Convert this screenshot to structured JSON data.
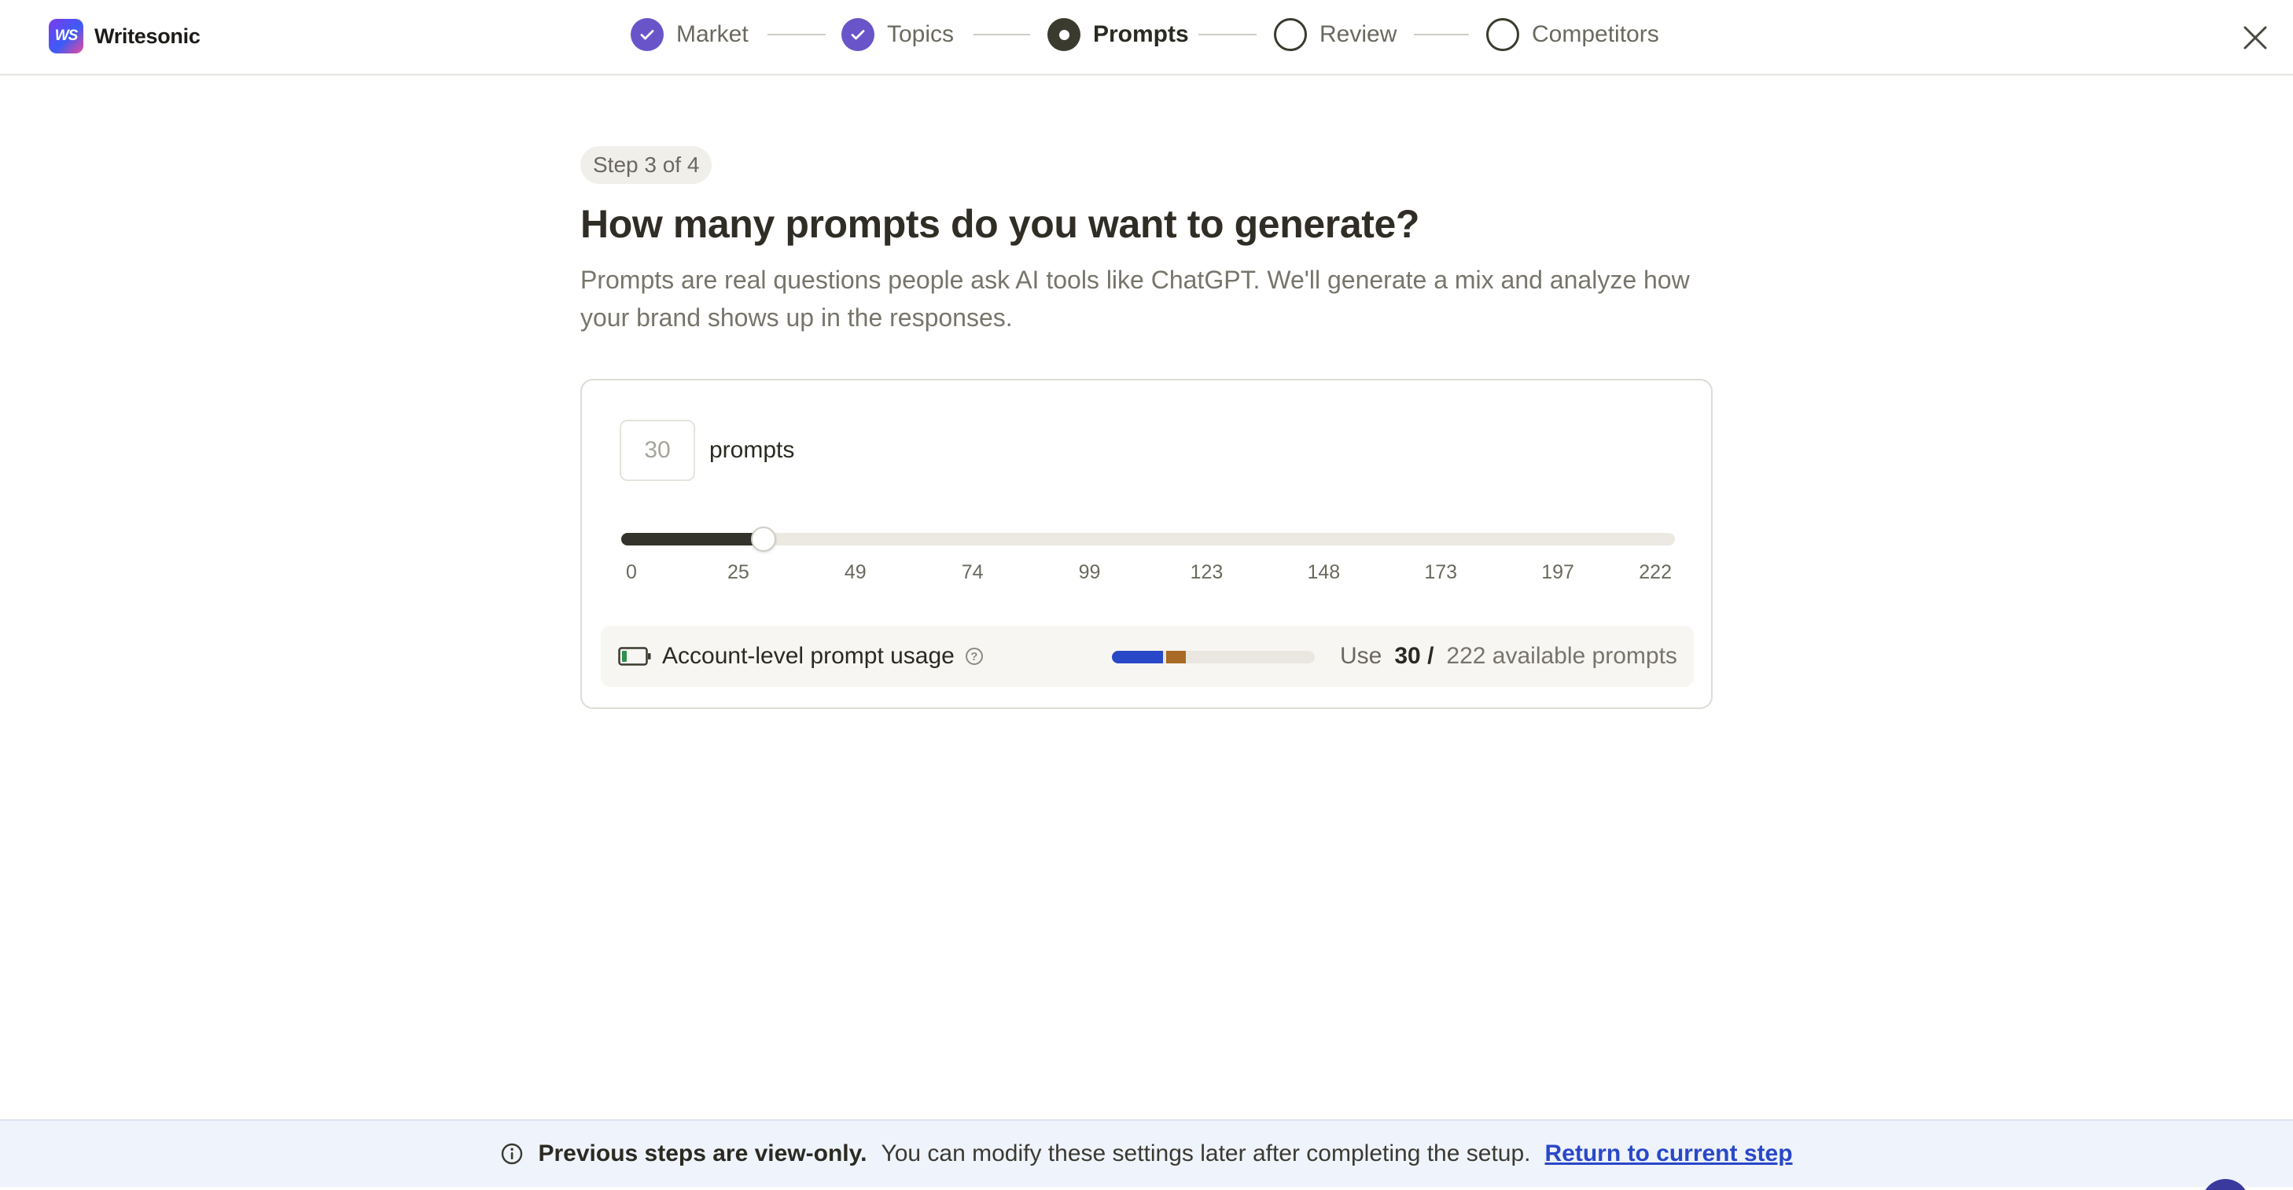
{
  "brand": {
    "name": "Writesonic",
    "logo_text": "WS"
  },
  "stepper": {
    "steps": [
      {
        "label": "Market",
        "state": "done"
      },
      {
        "label": "Topics",
        "state": "done"
      },
      {
        "label": "Prompts",
        "state": "current"
      },
      {
        "label": "Review",
        "state": "todo"
      },
      {
        "label": "Competitors",
        "state": "todo"
      }
    ]
  },
  "main": {
    "step_badge": "Step 3 of 4",
    "headline": "How many prompts do you want to generate?",
    "subtext": "Prompts are real questions people ask AI tools like ChatGPT. We'll generate a mix and analyze how your brand shows up in the responses."
  },
  "prompt_count": {
    "value": "30",
    "unit": "prompts",
    "slider_value": 30,
    "slider_min": 0,
    "slider_max": 222,
    "ticks": [
      "0",
      "25",
      "49",
      "74",
      "99",
      "123",
      "148",
      "173",
      "197",
      "222"
    ]
  },
  "usage": {
    "label": "Account-level prompt usage",
    "help_symbol": "?",
    "use_word": "Use",
    "use_value": "30 /",
    "available_text": "222 available prompts",
    "bar_used_fraction": 0.25,
    "bar_new_fraction": 0.1,
    "colors": {
      "used": "#2948c8",
      "new": "#a86a25"
    }
  },
  "banner": {
    "strong": "Previous steps are view-only.",
    "text": "You can modify these settings later after completing the setup.",
    "link": "Return to current step"
  },
  "colors": {
    "accent": "#6a54c9",
    "dark": "#33332b",
    "link": "#2948c8"
  }
}
